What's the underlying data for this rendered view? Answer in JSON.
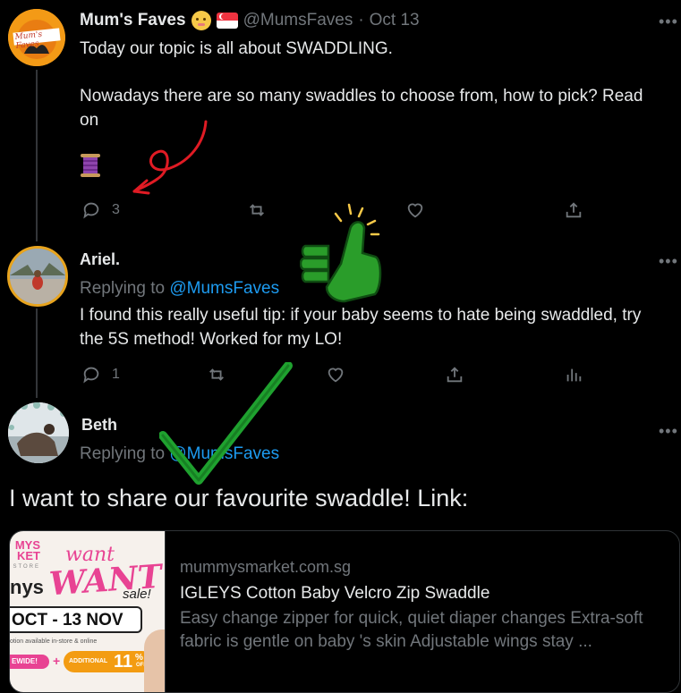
{
  "tweet1": {
    "name": "Mum's Faves",
    "emoji": "👶",
    "flag": "SG",
    "handle": "@MumsFaves",
    "sep": "·",
    "date": "Oct 13",
    "line1": "Today our topic is all about SWADDLING.",
    "line2": "Nowadays there are so many swaddles to choose from, how to pick? Read",
    "line3": "on",
    "thread_emoji": "🧵",
    "reply_count": "3",
    "avatar_text": "Mum's Faves"
  },
  "tweet2": {
    "name": "Ariel.",
    "replying_prefix": "Replying to",
    "replying_handle": "@MumsFaves",
    "line1": "I found this really useful tip: if your baby seems to hate being swaddled, try",
    "line2": "the 5S method! Worked for my LO!",
    "reply_count": "1"
  },
  "tweet3": {
    "name": "Beth",
    "replying_prefix": "Replying to",
    "replying_handle": "@MumsFaves",
    "text": "I want to share our favourite swaddle! Link:"
  },
  "link_card": {
    "domain": "mummysmarket.com.sg",
    "title": "IGLEYS Cotton Baby Velcro Zip Swaddle",
    "desc1": "Easy change zipper for quick, quiet diaper changes Extra-soft",
    "desc2": "fabric is gentle on baby 's skin  Adjustable wings stay ...",
    "img": {
      "logo1": "MYS",
      "logo2": "KET",
      "logo3": "STORE",
      "brand": "nys",
      "want1": "want",
      "want2": "WANT",
      "sale": "sale!",
      "dates": "OCT - 13 NOV",
      "note": "otion available in-store & online",
      "tag1": "EWIDE!",
      "plus": "+",
      "tag2": "ADDITIONAL",
      "pct": "11",
      "pct_sym": "%",
      "off": "OFF"
    }
  },
  "colors": {
    "accent": "#1d9bf0",
    "green": "#1fa12f",
    "red": "#e01b24",
    "muted": "#71767b"
  }
}
